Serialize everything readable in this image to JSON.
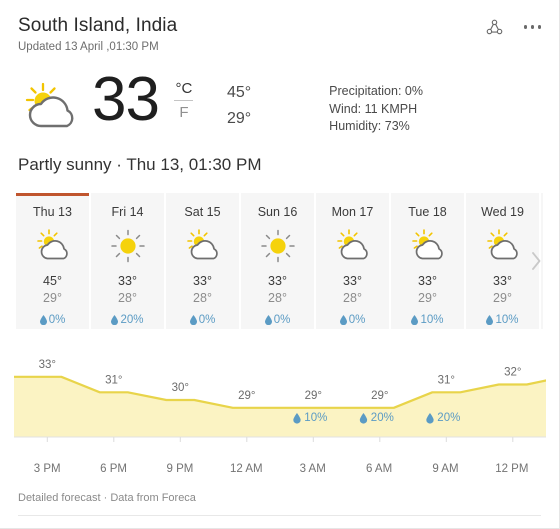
{
  "header": {
    "location": "South Island, India",
    "updated": "Updated 13 April ,01:30 PM",
    "share_icon": "share-icon",
    "more_icon": "more-options-icon"
  },
  "current": {
    "icon": "partly-sunny-icon",
    "temperature": "33",
    "unit_celsius": "°C",
    "unit_fahrenheit": "F",
    "high": "45°",
    "low": "29°",
    "precipitation": "Precipitation: 0%",
    "wind": "Wind: 11 KMPH",
    "humidity": "Humidity: 73%",
    "condition_line": "Partly sunny · Thu 13, 01:30 PM"
  },
  "forecast": {
    "days": [
      {
        "day": "Thu 13",
        "icon": "partly-sunny-icon",
        "high": "45°",
        "low": "29°",
        "precip": "0%",
        "active": true
      },
      {
        "day": "Fri 14",
        "icon": "sunny-icon",
        "high": "33°",
        "low": "28°",
        "precip": "20%",
        "active": false
      },
      {
        "day": "Sat 15",
        "icon": "partly-sunny-icon",
        "high": "33°",
        "low": "28°",
        "precip": "0%",
        "active": false
      },
      {
        "day": "Sun 16",
        "icon": "sunny-icon",
        "high": "33°",
        "low": "28°",
        "precip": "0%",
        "active": false
      },
      {
        "day": "Mon 17",
        "icon": "partly-sunny-icon",
        "high": "33°",
        "low": "28°",
        "precip": "0%",
        "active": false
      },
      {
        "day": "Tue 18",
        "icon": "partly-sunny-icon",
        "high": "33°",
        "low": "29°",
        "precip": "10%",
        "active": false
      },
      {
        "day": "Wed 19",
        "icon": "partly-sunny-icon",
        "high": "33°",
        "low": "29°",
        "precip": "10%",
        "active": false
      }
    ],
    "next_icon": "chevron-right-icon"
  },
  "chart_data": {
    "type": "area",
    "title": "",
    "xlabel": "",
    "ylabel": "",
    "grid": false,
    "legend": null,
    "ylim": [
      26,
      34
    ],
    "x": [
      "3 PM",
      "6 PM",
      "9 PM",
      "12 AM",
      "3 AM",
      "6 AM",
      "9 AM",
      "12 PM"
    ],
    "temperature_labels": [
      {
        "x": "3 PM",
        "value": "33°"
      },
      {
        "x": "6 PM",
        "value": "31°"
      },
      {
        "x": "9 PM",
        "value": "30°"
      },
      {
        "x": "12 AM",
        "value": "29°"
      },
      {
        "x": "3 AM",
        "value": "29°"
      },
      {
        "x": "6 AM",
        "value": "29°"
      },
      {
        "x": "9 AM",
        "value": "31°"
      },
      {
        "x": "12 PM",
        "value": "32°"
      }
    ],
    "values": [
      33,
      31,
      30,
      29,
      29,
      29,
      31,
      32
    ],
    "precipitation_markers": [
      {
        "x": "3 AM",
        "value": "10%"
      },
      {
        "x": "6 AM",
        "value": "20%"
      },
      {
        "x": "9 AM",
        "value": "20%"
      }
    ],
    "line_color": "#e8d44a",
    "fill_color": "#fbf3c3"
  },
  "footer": {
    "detailed_link": "Detailed forecast",
    "separator": "·",
    "source": "Data from Foreca"
  }
}
